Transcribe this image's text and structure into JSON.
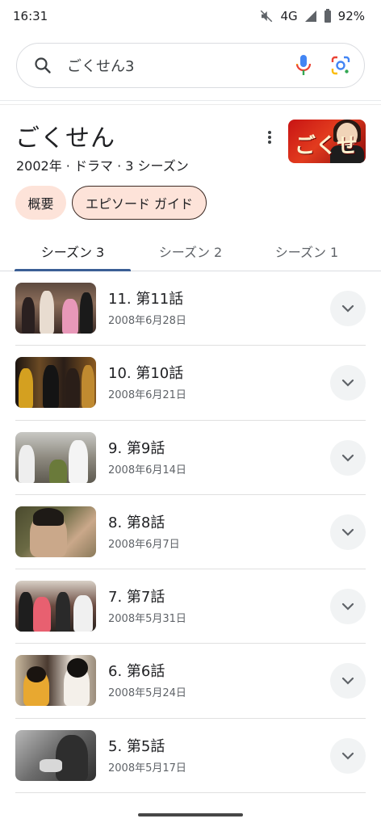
{
  "status": {
    "time": "16:31",
    "network": "4G",
    "battery": "92%"
  },
  "search": {
    "query": "ごくせん3",
    "icons": [
      "search-icon",
      "mic-icon",
      "lens-icon"
    ]
  },
  "entity": {
    "title": "ごくせん",
    "subtitle": "2002年 · ドラマ · 3 シーズン",
    "poster_text": "ごくせん"
  },
  "chips": {
    "overview": "概要",
    "episodes": "エピソード ガイド"
  },
  "tabs": [
    {
      "label": "シーズン 3",
      "active": true
    },
    {
      "label": "シーズン 2",
      "active": false
    },
    {
      "label": "シーズン 1",
      "active": false
    }
  ],
  "episodes": [
    {
      "title": "11. 第11話",
      "date": "2008年6月28日"
    },
    {
      "title": "10. 第10話",
      "date": "2008年6月21日"
    },
    {
      "title": "9. 第9話",
      "date": "2008年6月14日"
    },
    {
      "title": "8. 第8話",
      "date": "2008年6月7日"
    },
    {
      "title": "7. 第7話",
      "date": "2008年5月31日"
    },
    {
      "title": "6. 第6話",
      "date": "2008年5月24日"
    },
    {
      "title": "5. 第5話",
      "date": "2008年5月17日"
    }
  ],
  "colors": {
    "chip_bg": "#fde3d9",
    "tab_indicator": "#3b5f95",
    "mic_blue": "#4285f4",
    "mic_red": "#ea4335"
  }
}
